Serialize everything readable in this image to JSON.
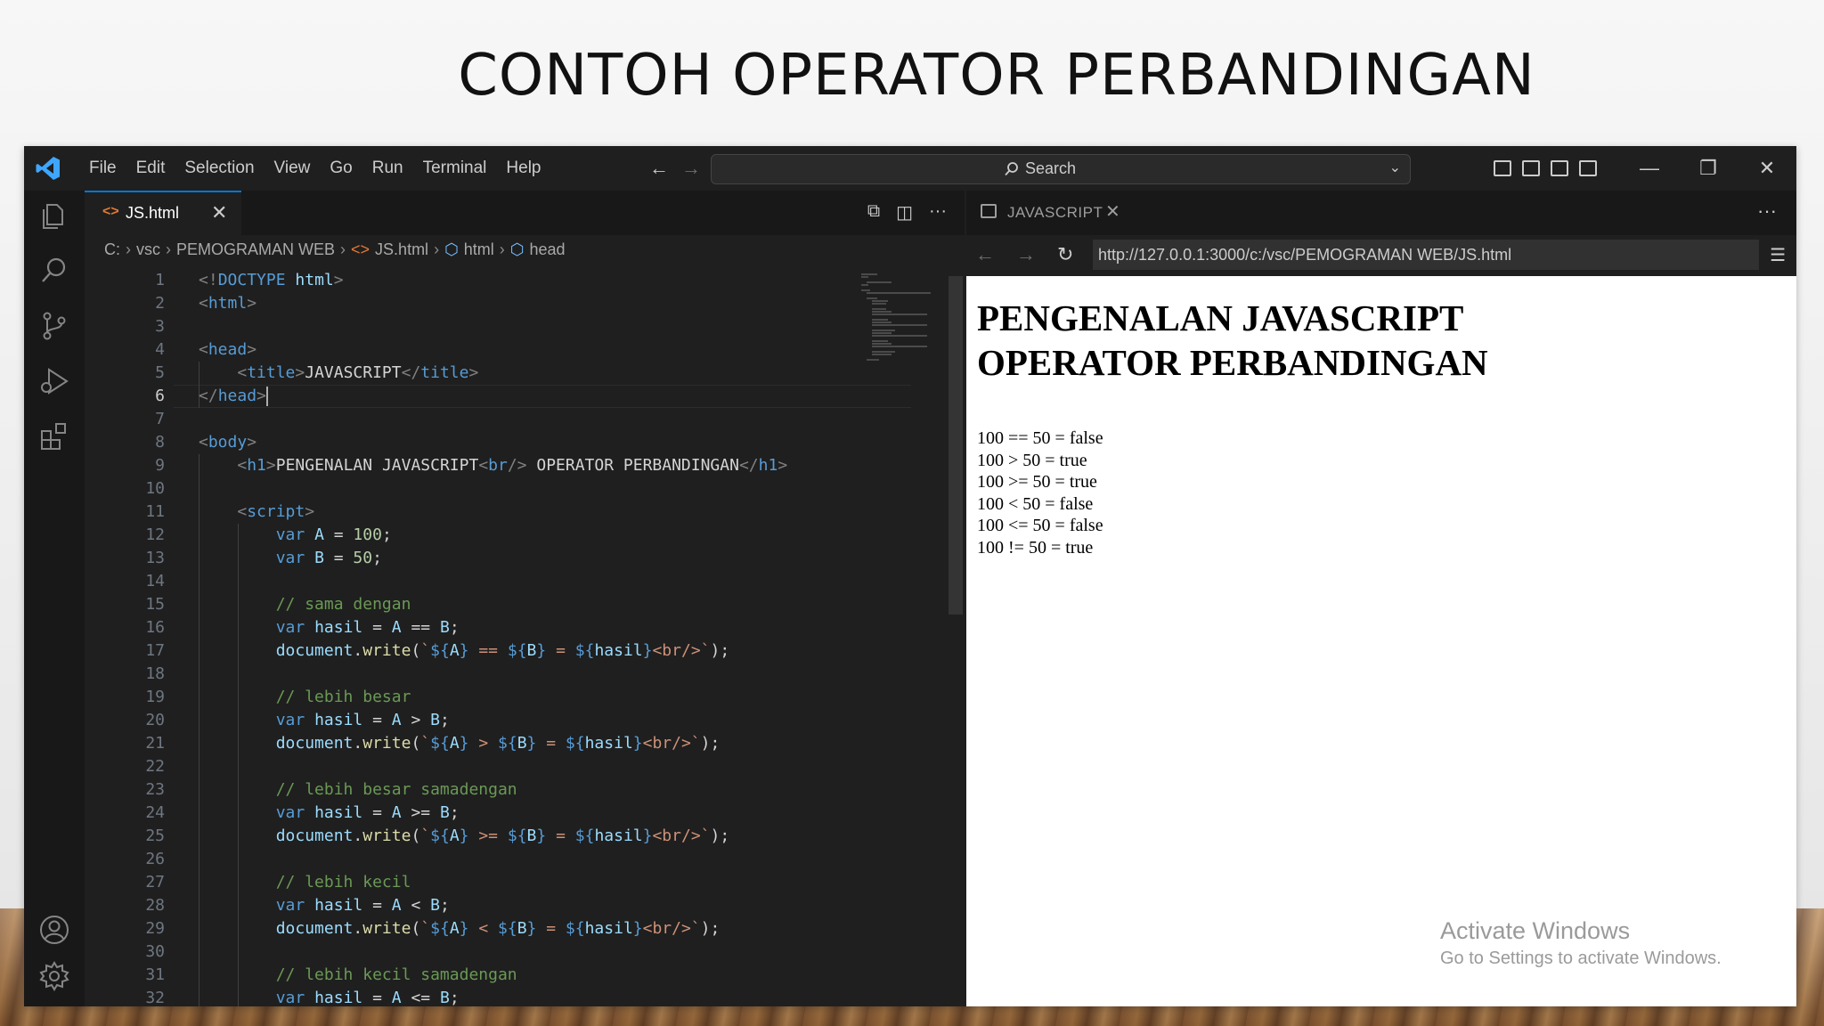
{
  "slide_title": "CONTOH OPERATOR PERBANDINGAN",
  "menu": [
    "File",
    "Edit",
    "Selection",
    "View",
    "Go",
    "Run",
    "Terminal",
    "Help"
  ],
  "search": {
    "label": "Search"
  },
  "editor": {
    "tab_label": "JS.html",
    "breadcrumb": [
      "C:",
      "vsc",
      "PEMOGRAMAN WEB",
      "JS.html",
      "html",
      "head"
    ],
    "active_line": 6
  },
  "preview": {
    "tab_label": "JAVASCRIPT",
    "url": "http://127.0.0.1:3000/c:/vsc/PEMOGRAMAN WEB/JS.html",
    "heading_line1": "PENGENALAN JAVASCRIPT",
    "heading_line2": "OPERATOR PERBANDINGAN",
    "results": [
      "100 == 50 = false",
      "100 > 50 = true",
      "100 >= 50 = true",
      "100 < 50 = false",
      "100 <= 50 = false",
      "100 != 50 = true"
    ]
  },
  "watermark": {
    "line1": "Activate Windows",
    "line2": "Go to Settings to activate Windows."
  },
  "code_lines": [
    [
      [
        "tg",
        "<!"
      ],
      [
        "tn",
        "DOCTYPE"
      ],
      [
        "tx",
        " "
      ],
      [
        "vn",
        "html"
      ],
      [
        "tg",
        ">"
      ]
    ],
    [
      [
        "tg",
        "<"
      ],
      [
        "tn",
        "html"
      ],
      [
        "tg",
        ">"
      ]
    ],
    [],
    [
      [
        "tg",
        "<"
      ],
      [
        "tn",
        "head"
      ],
      [
        "tg",
        ">"
      ]
    ],
    [
      [
        "tx",
        "    "
      ],
      [
        "tg",
        "<"
      ],
      [
        "tn",
        "title"
      ],
      [
        "tg",
        ">"
      ],
      [
        "tx",
        "JAVASCRIPT"
      ],
      [
        "tg",
        "</"
      ],
      [
        "tn",
        "title"
      ],
      [
        "tg",
        ">"
      ]
    ],
    [
      [
        "tg",
        "</"
      ],
      [
        "tn",
        "head"
      ],
      [
        "tg",
        ">"
      ]
    ],
    [],
    [
      [
        "tg",
        "<"
      ],
      [
        "tn",
        "body"
      ],
      [
        "tg",
        ">"
      ]
    ],
    [
      [
        "tx",
        "    "
      ],
      [
        "tg",
        "<"
      ],
      [
        "tn",
        "h1"
      ],
      [
        "tg",
        ">"
      ],
      [
        "tx",
        "PENGENALAN JAVASCRIPT"
      ],
      [
        "tg",
        "<"
      ],
      [
        "tn",
        "br"
      ],
      [
        "tg",
        "/>"
      ],
      [
        "tx",
        " OPERATOR PERBANDINGAN"
      ],
      [
        "tg",
        "</"
      ],
      [
        "tn",
        "h1"
      ],
      [
        "tg",
        ">"
      ]
    ],
    [],
    [
      [
        "tx",
        "    "
      ],
      [
        "tg",
        "<"
      ],
      [
        "tn",
        "script"
      ],
      [
        "tg",
        ">"
      ]
    ],
    [
      [
        "tx",
        "        "
      ],
      [
        "kw",
        "var"
      ],
      [
        "tx",
        " "
      ],
      [
        "vn",
        "A"
      ],
      [
        "op",
        " = "
      ],
      [
        "num",
        "100"
      ],
      [
        "op",
        ";"
      ]
    ],
    [
      [
        "tx",
        "        "
      ],
      [
        "kw",
        "var"
      ],
      [
        "tx",
        " "
      ],
      [
        "vn",
        "B"
      ],
      [
        "op",
        " = "
      ],
      [
        "num",
        "50"
      ],
      [
        "op",
        ";"
      ]
    ],
    [],
    [
      [
        "tx",
        "        "
      ],
      [
        "cm",
        "// sama dengan"
      ]
    ],
    [
      [
        "tx",
        "        "
      ],
      [
        "kw",
        "var"
      ],
      [
        "tx",
        " "
      ],
      [
        "vn",
        "hasil"
      ],
      [
        "op",
        " = "
      ],
      [
        "vn",
        "A"
      ],
      [
        "op",
        " == "
      ],
      [
        "vn",
        "B"
      ],
      [
        "op",
        ";"
      ]
    ],
    [
      [
        "tx",
        "        "
      ],
      [
        "vn",
        "document"
      ],
      [
        "op",
        "."
      ],
      [
        "fn",
        "write"
      ],
      [
        "op",
        "("
      ],
      [
        "st",
        "`"
      ],
      [
        "ip",
        "${"
      ],
      [
        "vn",
        "A"
      ],
      [
        "ip",
        "}"
      ],
      [
        "st",
        " == "
      ],
      [
        "ip",
        "${"
      ],
      [
        "vn",
        "B"
      ],
      [
        "ip",
        "}"
      ],
      [
        "st",
        " = "
      ],
      [
        "ip",
        "${"
      ],
      [
        "vn",
        "hasil"
      ],
      [
        "ip",
        "}"
      ],
      [
        "st",
        "<br/>`"
      ],
      [
        "op",
        ");"
      ]
    ],
    [],
    [
      [
        "tx",
        "        "
      ],
      [
        "cm",
        "// lebih besar"
      ]
    ],
    [
      [
        "tx",
        "        "
      ],
      [
        "kw",
        "var"
      ],
      [
        "tx",
        " "
      ],
      [
        "vn",
        "hasil"
      ],
      [
        "op",
        " = "
      ],
      [
        "vn",
        "A"
      ],
      [
        "op",
        " > "
      ],
      [
        "vn",
        "B"
      ],
      [
        "op",
        ";"
      ]
    ],
    [
      [
        "tx",
        "        "
      ],
      [
        "vn",
        "document"
      ],
      [
        "op",
        "."
      ],
      [
        "fn",
        "write"
      ],
      [
        "op",
        "("
      ],
      [
        "st",
        "`"
      ],
      [
        "ip",
        "${"
      ],
      [
        "vn",
        "A"
      ],
      [
        "ip",
        "}"
      ],
      [
        "st",
        " > "
      ],
      [
        "ip",
        "${"
      ],
      [
        "vn",
        "B"
      ],
      [
        "ip",
        "}"
      ],
      [
        "st",
        " = "
      ],
      [
        "ip",
        "${"
      ],
      [
        "vn",
        "hasil"
      ],
      [
        "ip",
        "}"
      ],
      [
        "st",
        "<br/>`"
      ],
      [
        "op",
        ");"
      ]
    ],
    [],
    [
      [
        "tx",
        "        "
      ],
      [
        "cm",
        "// lebih besar samadengan"
      ]
    ],
    [
      [
        "tx",
        "        "
      ],
      [
        "kw",
        "var"
      ],
      [
        "tx",
        " "
      ],
      [
        "vn",
        "hasil"
      ],
      [
        "op",
        " = "
      ],
      [
        "vn",
        "A"
      ],
      [
        "op",
        " >= "
      ],
      [
        "vn",
        "B"
      ],
      [
        "op",
        ";"
      ]
    ],
    [
      [
        "tx",
        "        "
      ],
      [
        "vn",
        "document"
      ],
      [
        "op",
        "."
      ],
      [
        "fn",
        "write"
      ],
      [
        "op",
        "("
      ],
      [
        "st",
        "`"
      ],
      [
        "ip",
        "${"
      ],
      [
        "vn",
        "A"
      ],
      [
        "ip",
        "}"
      ],
      [
        "st",
        " >= "
      ],
      [
        "ip",
        "${"
      ],
      [
        "vn",
        "B"
      ],
      [
        "ip",
        "}"
      ],
      [
        "st",
        " = "
      ],
      [
        "ip",
        "${"
      ],
      [
        "vn",
        "hasil"
      ],
      [
        "ip",
        "}"
      ],
      [
        "st",
        "<br/>`"
      ],
      [
        "op",
        ");"
      ]
    ],
    [],
    [
      [
        "tx",
        "        "
      ],
      [
        "cm",
        "// lebih kecil"
      ]
    ],
    [
      [
        "tx",
        "        "
      ],
      [
        "kw",
        "var"
      ],
      [
        "tx",
        " "
      ],
      [
        "vn",
        "hasil"
      ],
      [
        "op",
        " = "
      ],
      [
        "vn",
        "A"
      ],
      [
        "op",
        " < "
      ],
      [
        "vn",
        "B"
      ],
      [
        "op",
        ";"
      ]
    ],
    [
      [
        "tx",
        "        "
      ],
      [
        "vn",
        "document"
      ],
      [
        "op",
        "."
      ],
      [
        "fn",
        "write"
      ],
      [
        "op",
        "("
      ],
      [
        "st",
        "`"
      ],
      [
        "ip",
        "${"
      ],
      [
        "vn",
        "A"
      ],
      [
        "ip",
        "}"
      ],
      [
        "st",
        " < "
      ],
      [
        "ip",
        "${"
      ],
      [
        "vn",
        "B"
      ],
      [
        "ip",
        "}"
      ],
      [
        "st",
        " = "
      ],
      [
        "ip",
        "${"
      ],
      [
        "vn",
        "hasil"
      ],
      [
        "ip",
        "}"
      ],
      [
        "st",
        "<br/>`"
      ],
      [
        "op",
        ");"
      ]
    ],
    [],
    [
      [
        "tx",
        "        "
      ],
      [
        "cm",
        "// lebih kecil samadengan"
      ]
    ],
    [
      [
        "tx",
        "        "
      ],
      [
        "kw",
        "var"
      ],
      [
        "tx",
        " "
      ],
      [
        "vn",
        "hasil"
      ],
      [
        "op",
        " = "
      ],
      [
        "vn",
        "A"
      ],
      [
        "op",
        " <= "
      ],
      [
        "vn",
        "B"
      ],
      [
        "op",
        ";"
      ]
    ]
  ]
}
